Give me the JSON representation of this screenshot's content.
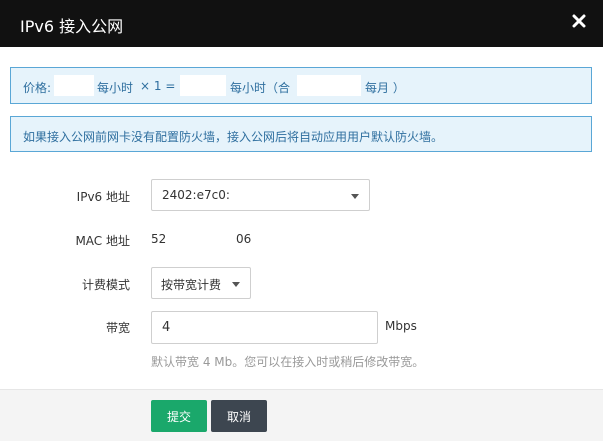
{
  "dialog": {
    "title": "IPv6 接入公网"
  },
  "price_bar": {
    "prefix": "价格:",
    "per_hour": "每小时",
    "multiplier": "× 1 =",
    "per_hour_total": "每小时（合",
    "per_month": "每月 ）"
  },
  "notice": {
    "text": "如果接入公网前网卡没有配置防火墙，接入公网后将自动应用用户默认防火墙。"
  },
  "form": {
    "ipv6": {
      "label": "IPv6 地址",
      "value": "2402:e7c0:"
    },
    "mac": {
      "label": "MAC 地址",
      "value_start": "52",
      "value_end": "06"
    },
    "billing": {
      "label": "计费模式",
      "value": "按带宽计费"
    },
    "bandwidth": {
      "label": "带宽",
      "value": "4",
      "unit": "Mbps",
      "hint": "默认带宽 4 Mb。您可以在接入时或稍后修改带宽。"
    }
  },
  "buttons": {
    "submit": "提交",
    "cancel": "取消"
  }
}
